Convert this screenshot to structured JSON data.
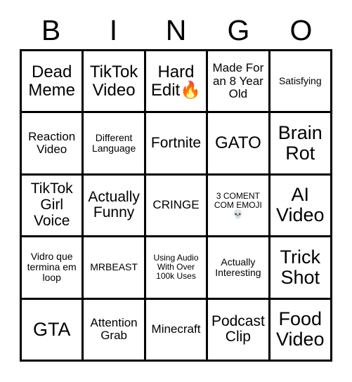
{
  "card": {
    "type": "bingo-card",
    "columns": 5,
    "rows": 5,
    "background_color": "#ffffff",
    "text_color": "#000000",
    "border_color": "#000000"
  },
  "header": {
    "letters": [
      "B",
      "I",
      "N",
      "G",
      "O"
    ]
  },
  "grid": {
    "cells": [
      {
        "text": "Dead Meme",
        "size": "xl"
      },
      {
        "text": "TikTok Video",
        "size": "xl"
      },
      {
        "text": "Hard Edit🔥",
        "size": "xl"
      },
      {
        "text": "Made For an 8 Year Old",
        "size": "md"
      },
      {
        "text": "Satisfying",
        "size": "sm"
      },
      {
        "text": "Reaction Video",
        "size": "md"
      },
      {
        "text": "Different Language",
        "size": "sm"
      },
      {
        "text": "Fortnite",
        "size": "lg"
      },
      {
        "text": "GATO",
        "size": "xl"
      },
      {
        "text": "Brain Rot",
        "size": "xxl"
      },
      {
        "text": "TikTok Girl Voice",
        "size": "lg"
      },
      {
        "text": "Actually Funny",
        "size": "lg"
      },
      {
        "text": "CRINGE",
        "size": "md"
      },
      {
        "text": "3 COMENT COM EMOJI 💀",
        "size": "xs"
      },
      {
        "text": "AI Video",
        "size": "xxl"
      },
      {
        "text": "Vidro que termina em loop",
        "size": "sm"
      },
      {
        "text": "MRBEAST",
        "size": "sm"
      },
      {
        "text": "Using Audio With Over 100k Uses",
        "size": "xs"
      },
      {
        "text": "Actually Interesting",
        "size": "sm"
      },
      {
        "text": "Trick Shot",
        "size": "xxl"
      },
      {
        "text": "GTA",
        "size": "xxl"
      },
      {
        "text": "Attention Grab",
        "size": "md"
      },
      {
        "text": "Minecraft",
        "size": "md"
      },
      {
        "text": "Podcast Clip",
        "size": "lg"
      },
      {
        "text": "Food Video",
        "size": "xxl"
      }
    ]
  }
}
